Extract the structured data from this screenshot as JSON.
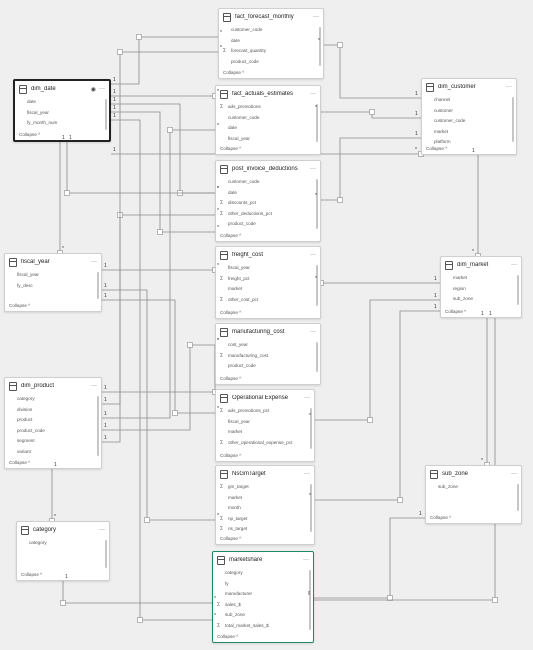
{
  "tables": [
    {
      "id": "fact_forecast_monthly",
      "title": "fact_forecast_monthly",
      "fields": [
        {
          "name": "customer_code",
          "sum": false
        },
        {
          "name": "date",
          "sum": false
        },
        {
          "name": "forecast_quantity",
          "sum": true
        },
        {
          "name": "product_code",
          "sum": false
        }
      ],
      "collapse": "Collapse ^"
    },
    {
      "id": "dim_date",
      "title": "dim_date",
      "fields": [
        {
          "name": "date",
          "sum": false
        },
        {
          "name": "fiscal_year",
          "sum": false
        },
        {
          "name": "fy_month_num",
          "sum": false
        }
      ],
      "collapse": "Collapse ^"
    },
    {
      "id": "fact_actuals_estimates",
      "title": "fact_actuals_estimates",
      "fields": [
        {
          "name": "ads_promotions",
          "sum": true
        },
        {
          "name": "customer_code",
          "sum": false
        },
        {
          "name": "date",
          "sum": false
        },
        {
          "name": "fiscal_year",
          "sum": false
        }
      ],
      "collapse": "Collapse ^"
    },
    {
      "id": "dim_customer",
      "title": "dim_customer",
      "fields": [
        {
          "name": "channel",
          "sum": false
        },
        {
          "name": "customer",
          "sum": false
        },
        {
          "name": "customer_code",
          "sum": false
        },
        {
          "name": "market",
          "sum": false
        },
        {
          "name": "platform",
          "sum": false
        }
      ],
      "collapse": "Collapse ^"
    },
    {
      "id": "post_invoice_deductions",
      "title": "post_invoice_deductions",
      "fields": [
        {
          "name": "customer_code",
          "sum": false
        },
        {
          "name": "date",
          "sum": false
        },
        {
          "name": "discounts_pct",
          "sum": true
        },
        {
          "name": "other_deductions_pct",
          "sum": true
        },
        {
          "name": "product_code",
          "sum": false
        }
      ],
      "collapse": "Collapse ^"
    },
    {
      "id": "fiscal_year",
      "title": "fiscal_year",
      "fields": [
        {
          "name": "fiscal_year",
          "sum": false
        },
        {
          "name": "fy_desc",
          "sum": false
        }
      ],
      "collapse": "Collapse ^"
    },
    {
      "id": "freight_cost",
      "title": "freight_cost",
      "fields": [
        {
          "name": "fiscal_year",
          "sum": false
        },
        {
          "name": "freight_pct",
          "sum": true
        },
        {
          "name": "market",
          "sum": false
        },
        {
          "name": "other_cost_pct",
          "sum": true
        }
      ],
      "collapse": "Collapse ^"
    },
    {
      "id": "dim_market",
      "title": "dim_market",
      "fields": [
        {
          "name": "market",
          "sum": false
        },
        {
          "name": "region",
          "sum": false
        },
        {
          "name": "sub_zone",
          "sum": false
        }
      ],
      "collapse": "Collapse ^"
    },
    {
      "id": "manufacturing_cost",
      "title": "manufacturing_cost",
      "fields": [
        {
          "name": "cost_year",
          "sum": false
        },
        {
          "name": "manufacturing_cost",
          "sum": true
        },
        {
          "name": "product_code",
          "sum": false
        }
      ],
      "collapse": "Collapse ^"
    },
    {
      "id": "dim_product",
      "title": "dim_product",
      "fields": [
        {
          "name": "category",
          "sum": false
        },
        {
          "name": "division",
          "sum": false
        },
        {
          "name": "product",
          "sum": false
        },
        {
          "name": "product_code",
          "sum": false
        },
        {
          "name": "segment",
          "sum": false
        },
        {
          "name": "variant",
          "sum": false
        }
      ],
      "collapse": "Collapse ^"
    },
    {
      "id": "operational_expense",
      "title": "Operational Expense",
      "fields": [
        {
          "name": "ads_promotions_pct",
          "sum": true
        },
        {
          "name": "fiscal_year",
          "sum": false
        },
        {
          "name": "market",
          "sum": false
        },
        {
          "name": "other_operational_expense_pct",
          "sum": true
        }
      ],
      "collapse": "Collapse ^"
    },
    {
      "id": "nsgm_target",
      "title": "NsGmTarget",
      "fields": [
        {
          "name": "gm_target",
          "sum": true
        },
        {
          "name": "market",
          "sum": false
        },
        {
          "name": "month",
          "sum": false
        },
        {
          "name": "np_target",
          "sum": true
        },
        {
          "name": "ns_target",
          "sum": true
        }
      ],
      "collapse": "Collapse ^"
    },
    {
      "id": "sub_zone",
      "title": "sub_zone",
      "fields": [
        {
          "name": "sub_zone",
          "sum": false
        }
      ],
      "collapse": "Collapse ^"
    },
    {
      "id": "category",
      "title": "category",
      "fields": [
        {
          "name": "category",
          "sum": false
        }
      ],
      "collapse": "Collapse ^"
    },
    {
      "id": "marketshare",
      "title": "marketshare",
      "fields": [
        {
          "name": "category",
          "sum": false
        },
        {
          "name": "fy",
          "sum": false
        },
        {
          "name": "manufacturer",
          "sum": false
        },
        {
          "name": "sales_$",
          "sum": true
        },
        {
          "name": "sub_zone",
          "sum": false
        },
        {
          "name": "total_market_sales_$",
          "sum": true
        }
      ],
      "collapse": "Collapse ^"
    }
  ],
  "cardinality": {
    "one": "1",
    "many": "*"
  },
  "colors": {
    "canvas": "#efefef",
    "card": "#ffffff",
    "line": "#8a8a8a",
    "selected_border": "#222222",
    "highlight_border": "#1f8a63"
  }
}
